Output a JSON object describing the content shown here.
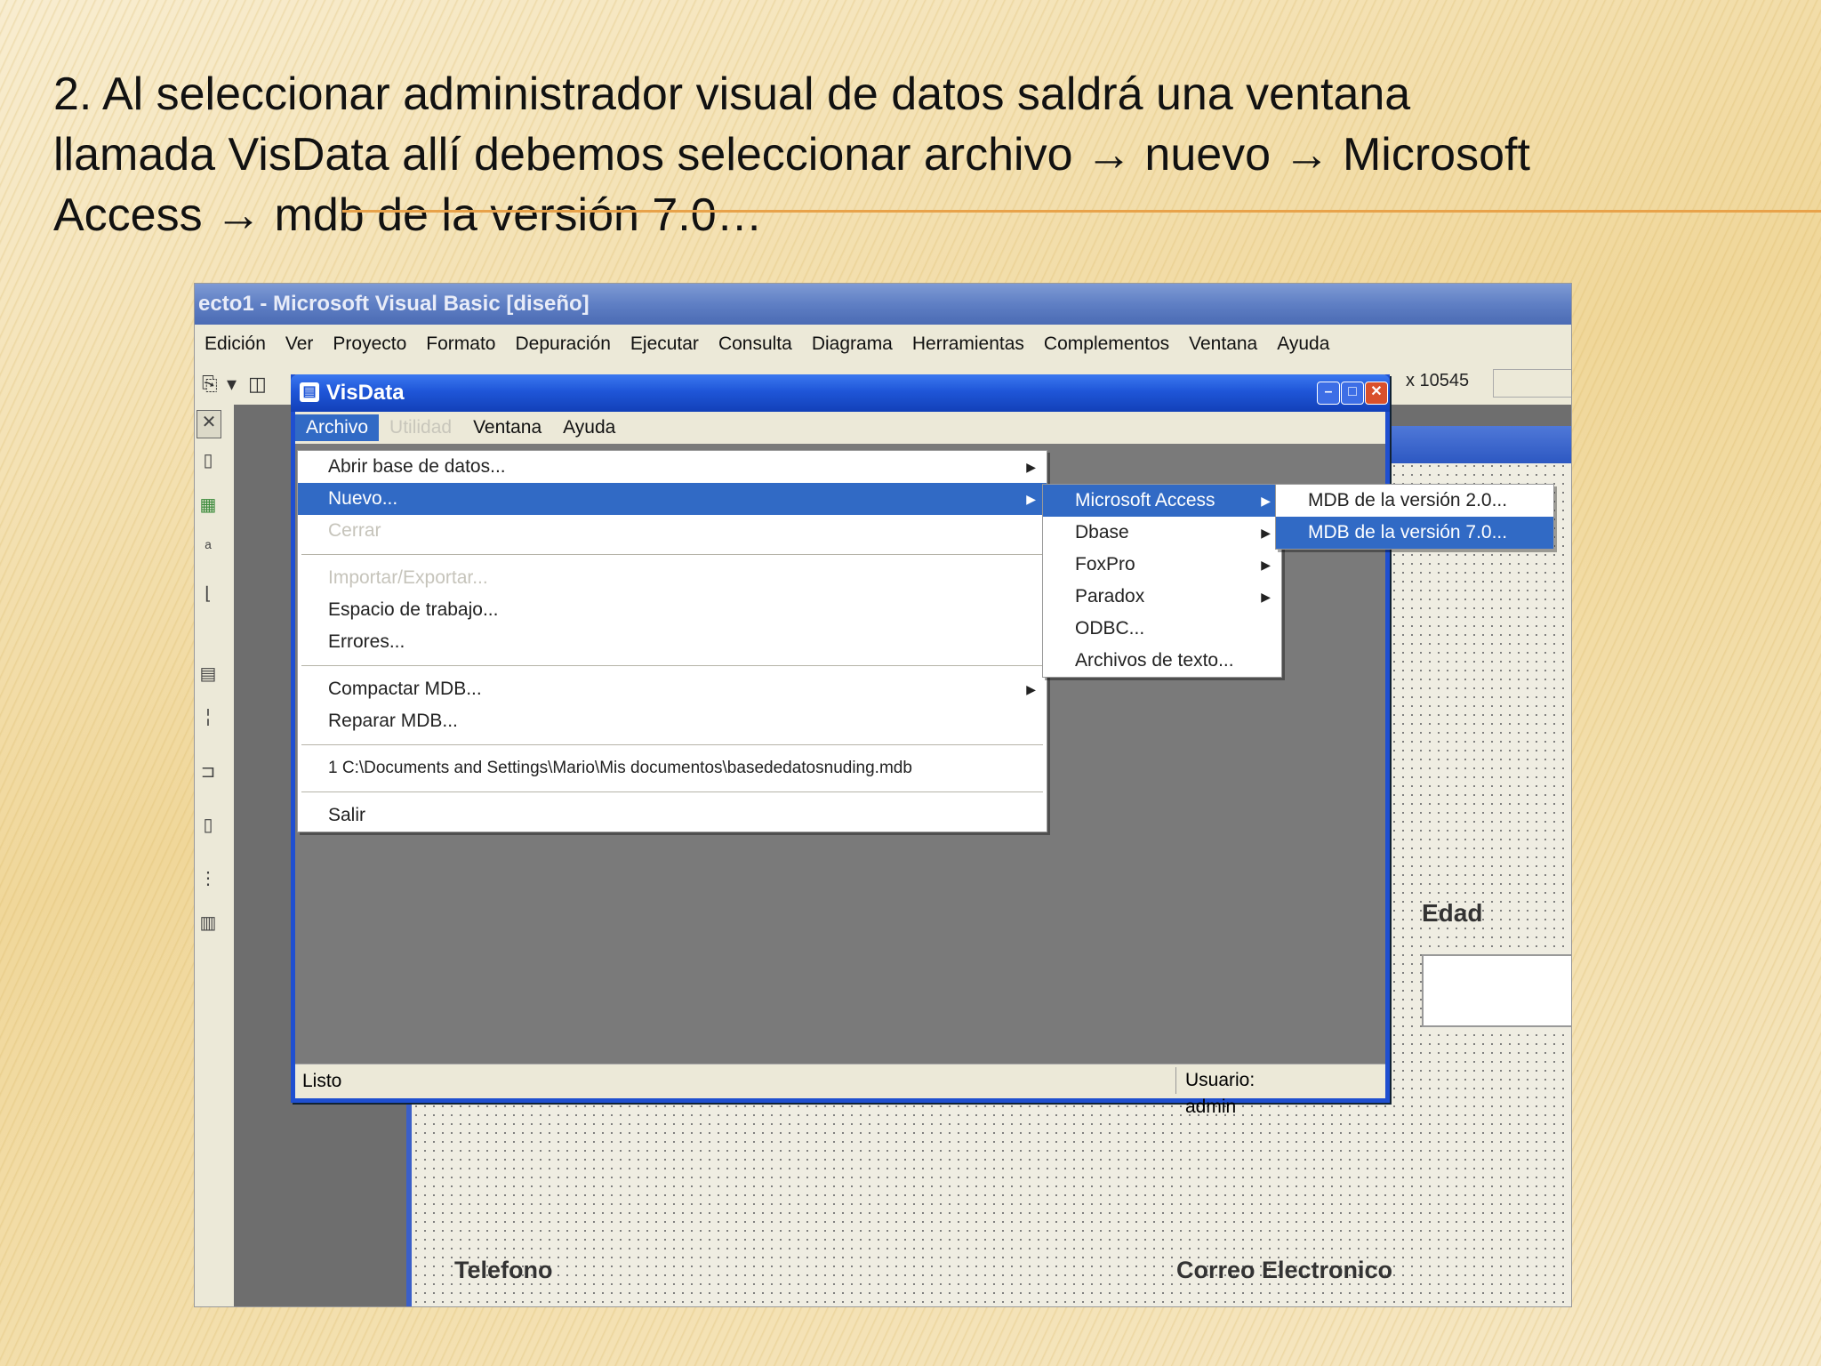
{
  "slide": {
    "title_lines": [
      "2. Al seleccionar administrador visual de datos  saldrá una ventana",
      "llamada VisData  allí debemos seleccionar archivo → nuevo → Microsoft",
      "Access          → mdb de la versión 7.0…"
    ]
  },
  "vb": {
    "title": "ecto1 - Microsoft Visual Basic [diseño]",
    "menu": [
      "Edición",
      "Ver",
      "Proyecto",
      "Formato",
      "Depuración",
      "Ejecutar",
      "Consulta",
      "Diagrama",
      "Herramientas",
      "Complementos",
      "Ventana",
      "Ayuda"
    ],
    "coords": "x 10545",
    "form_labels": {
      "edad": "Edad",
      "telefono": "Telefono",
      "correo": "Correo Electronico"
    }
  },
  "visdata": {
    "title": "VisData",
    "menu": [
      "Archivo",
      "Utilidad",
      "Ventana",
      "Ayuda"
    ],
    "status_left": "Listo",
    "status_right": "Usuario: admin",
    "file_menu": {
      "abrir": "Abrir base de datos...",
      "nuevo": "Nuevo...",
      "cerrar": "Cerrar",
      "importar": "Importar/Exportar...",
      "espacio": "Espacio de trabajo...",
      "errores": "Errores...",
      "compactar": "Compactar MDB...",
      "reparar": "Reparar MDB...",
      "recent": "1 C:\\Documents and Settings\\Mario\\Mis documentos\\basededatosnuding.mdb",
      "salir": "Salir"
    },
    "nuevo_menu": [
      "Microsoft Access",
      "Dbase",
      "FoxPro",
      "Paradox",
      "ODBC...",
      "Archivos de texto..."
    ],
    "access_menu": [
      "MDB de la versión 2.0...",
      "MDB de la versión 7.0..."
    ]
  },
  "colors": {
    "selection": "#316ac5",
    "xp_title": "#1f56d8",
    "accent_rule": "#e8a24a"
  }
}
